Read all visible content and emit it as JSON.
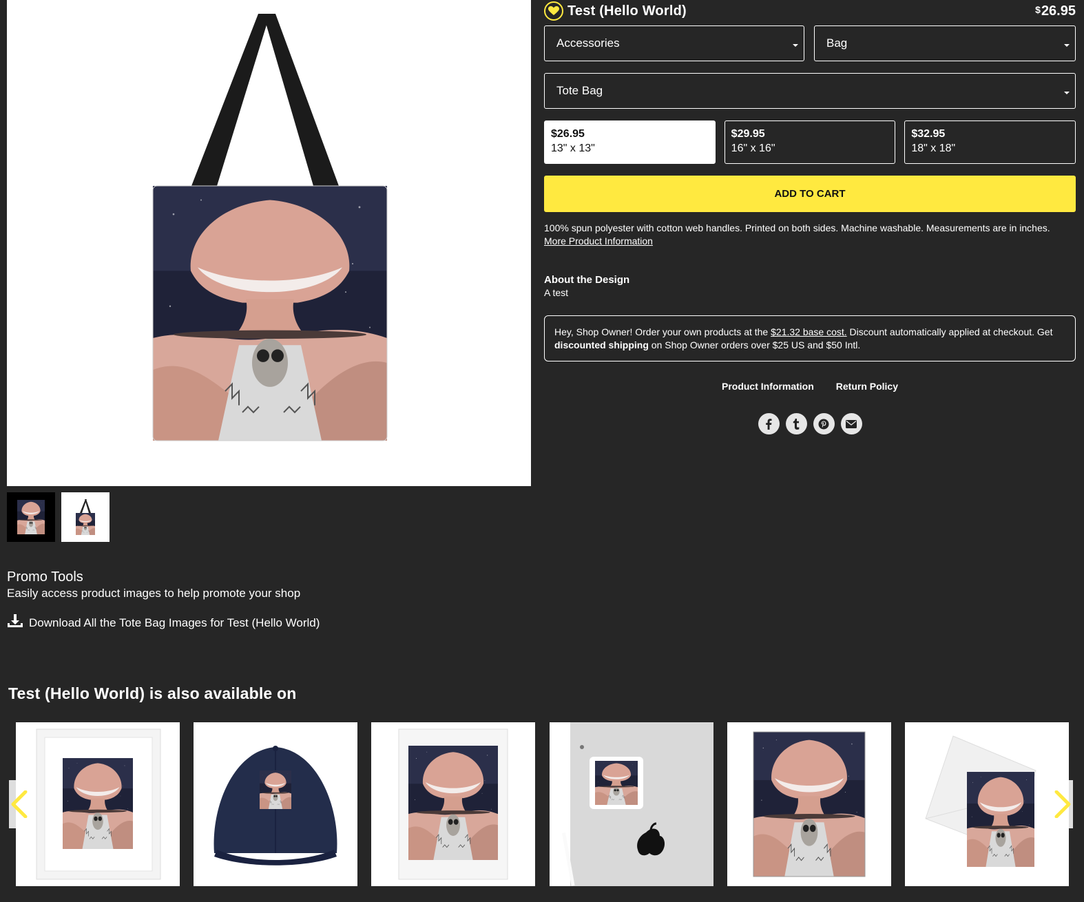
{
  "product": {
    "title": "Test (Hello World)",
    "price_symbol": "$",
    "price_amount": "26.95"
  },
  "selects": {
    "category": "Accessories",
    "type": "Bag",
    "product": "Tote Bag"
  },
  "sizes": [
    {
      "price": "$26.95",
      "dim": "13\" x 13\"",
      "selected": true
    },
    {
      "price": "$29.95",
      "dim": "16\" x 16\"",
      "selected": false
    },
    {
      "price": "$32.95",
      "dim": "18\" x 18\"",
      "selected": false
    }
  ],
  "add_to_cart": "ADD TO CART",
  "description": {
    "text": "100% spun polyester with cotton web handles. Printed on both sides. Machine washable. Measurements are in inches.",
    "more_link": "More Product Information"
  },
  "about": {
    "title": "About the Design",
    "text": "A test"
  },
  "owner_notice": {
    "part1": "Hey, Shop Owner! Order your own products at the ",
    "link": "$21.32 base cost.",
    "part2": " Discount automatically applied at checkout. Get ",
    "bold": "discounted shipping",
    "part3": " on Shop Owner orders over $25 US and $50 Intl."
  },
  "info_links": {
    "product_info": "Product Information",
    "return_policy": "Return Policy"
  },
  "social_icons": [
    "facebook-icon",
    "tumblr-icon",
    "pinterest-icon",
    "email-icon"
  ],
  "promo": {
    "title": "Promo Tools",
    "subtitle": "Easily access product images to help promote your shop",
    "download": "Download All the Tote Bag Images for Test (Hello World)"
  },
  "also_available": {
    "title": "Test (Hello World) is also available on",
    "items": [
      "framed-print",
      "trucker-cap",
      "art-print",
      "laptop-sticker",
      "jigsaw-puzzle",
      "greeting-card"
    ]
  },
  "colors": {
    "background": "#262626",
    "accent_yellow": "#ffe940",
    "white": "#ffffff"
  }
}
